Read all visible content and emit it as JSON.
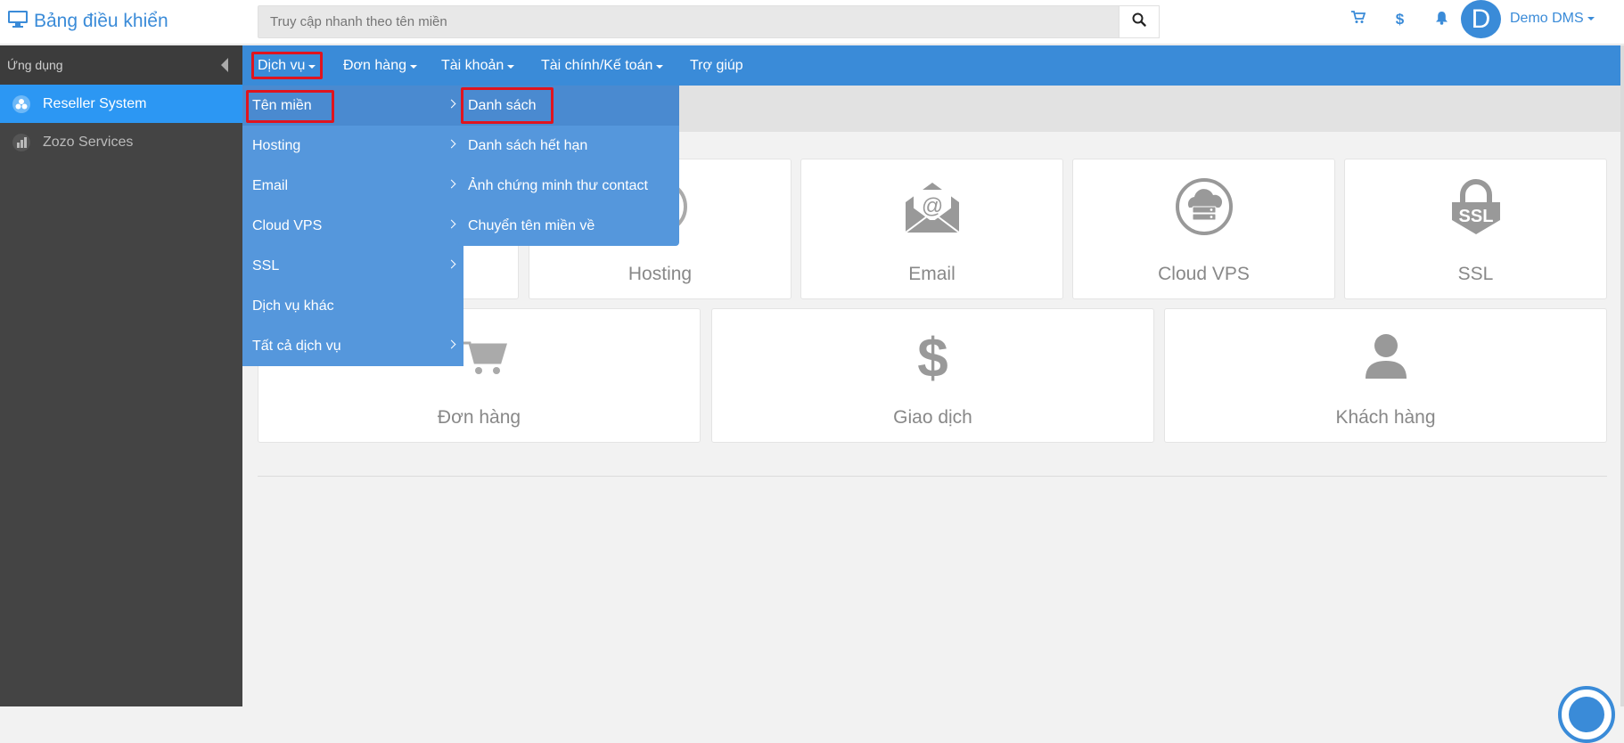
{
  "app": {
    "title": "Bảng điều khiển"
  },
  "search": {
    "placeholder": "Truy cập nhanh theo tên miền"
  },
  "user": {
    "initial": "D",
    "name": "Demo DMS"
  },
  "sidebar": {
    "header": "Ứng dụng",
    "items": [
      {
        "label": "Reseller System",
        "active": true
      },
      {
        "label": "Zozo Services",
        "active": false
      }
    ]
  },
  "nav": {
    "items": [
      {
        "label": "Dịch vụ"
      },
      {
        "label": "Đơn hàng"
      },
      {
        "label": "Tài khoản"
      },
      {
        "label": "Tài chính/Kế toán"
      },
      {
        "label": "Trợ giúp"
      }
    ]
  },
  "service_menu": {
    "items": [
      {
        "label": "Tên miền"
      },
      {
        "label": "Hosting"
      },
      {
        "label": "Email"
      },
      {
        "label": "Cloud VPS"
      },
      {
        "label": "SSL"
      },
      {
        "label": "Dịch vụ khác"
      },
      {
        "label": "Tất cả dịch vụ"
      }
    ]
  },
  "domain_submenu": {
    "items": [
      {
        "label": "Danh sách"
      },
      {
        "label": "Danh sách hết hạn"
      },
      {
        "label": "Ảnh chứng minh thư contact"
      },
      {
        "label": "Chuyển tên miền về"
      }
    ]
  },
  "dashboard": {
    "row1": [
      {
        "label": "Hosting",
        "icon": "hosting-icon"
      },
      {
        "label": "Email",
        "icon": "email-icon"
      },
      {
        "label": "Cloud VPS",
        "icon": "cloud-server-icon"
      },
      {
        "label": "SSL",
        "icon": "ssl-lock-icon",
        "icon_text": "SSL"
      }
    ],
    "row2": [
      {
        "label": "Đơn hàng",
        "icon": "cart-icon"
      },
      {
        "label": "Giao dịch",
        "icon": "dollar-icon",
        "icon_text": "$"
      },
      {
        "label": "Khách hàng",
        "icon": "user-icon"
      }
    ]
  },
  "colors": {
    "primary": "#3a8bd8",
    "menu": "#5597dc",
    "highlight": "#e0141e",
    "sidebar": "#444444",
    "active": "#2c97f3"
  }
}
